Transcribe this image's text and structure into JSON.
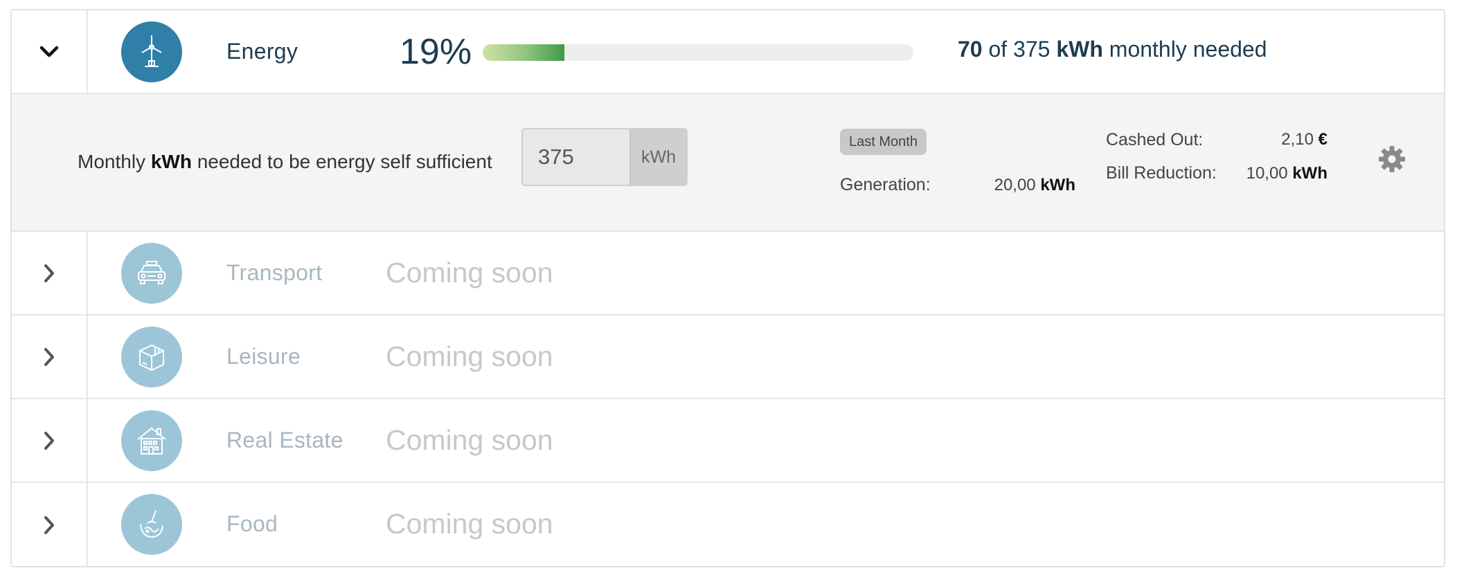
{
  "energy": {
    "label": "Energy",
    "percent_text": "19%",
    "progress_fraction": 0.19,
    "needed_current": "70",
    "needed_of": "of 375",
    "needed_unit": "kWh",
    "needed_suffix": "monthly needed",
    "monthly_prefix": "Monthly",
    "monthly_unit": "kWh",
    "monthly_suffix": "needed to be energy self sufficient",
    "input_value": "375",
    "input_unit": "kWh",
    "badge": "Last Month",
    "generation_label": "Generation:",
    "generation_value": "20,00",
    "generation_unit": "kWh",
    "cashed_label": "Cashed Out:",
    "cashed_value": "2,10",
    "cashed_unit": "€",
    "bill_label": "Bill Reduction:",
    "bill_value": "10,00",
    "bill_unit": "kWh"
  },
  "categories": [
    {
      "label": "Transport",
      "status": "Coming soon",
      "icon": "car-icon"
    },
    {
      "label": "Leisure",
      "status": "Coming soon",
      "icon": "box-icon"
    },
    {
      "label": "Real Estate",
      "status": "Coming soon",
      "icon": "house-icon"
    },
    {
      "label": "Food",
      "status": "Coming soon",
      "icon": "food-icon"
    }
  ],
  "colors": {
    "energy_icon_bg": "#2f7fa8",
    "inactive_icon_bg": "#9dc5d8",
    "energy_label": "#1d3c50",
    "inactive_label": "#a8b7c0",
    "progress_fill_end": "#3f9a49"
  }
}
